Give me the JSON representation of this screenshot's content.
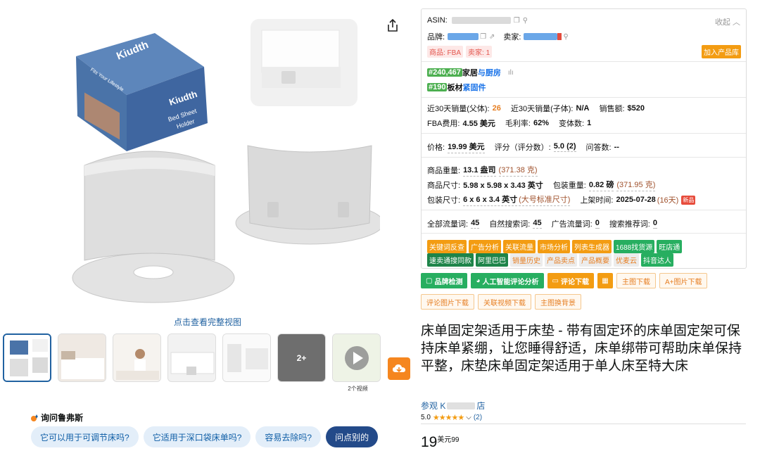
{
  "gallery": {
    "view_full_label": "点击查看完整视图",
    "video_count_label": "2个视频",
    "more_thumbs_label": "2+",
    "box_brand": "Kiudth",
    "box_slogan": "Fits Your Lifestyle",
    "box_product_lines": [
      "Bed Sheet",
      "Holder"
    ]
  },
  "rufus": {
    "title": "询问鲁弗斯",
    "questions": [
      "它可以用于可调节床吗?",
      "它适用于深口袋床单吗?",
      "容易去除吗?",
      "问点别的"
    ]
  },
  "panel": {
    "asin_label": "ASIN:",
    "collapse_label": "收起",
    "brand_label": "品牌:",
    "seller_label": "卖家:",
    "product_tag": "商品: FBA",
    "seller_tag": "卖家: 1",
    "add_library": "加入产品库",
    "rank1": {
      "rank": "#240,467",
      "cat1": "家居",
      "cat2": "与厨房"
    },
    "rank2": {
      "rank": "#190",
      "cat1": "板材",
      "cat2": "紧固件"
    },
    "sales30_parent_label": "近30天销量(父体):",
    "sales30_parent": "26",
    "sales30_child_label": "近30天销量(子体):",
    "sales30_child": "N/A",
    "revenue_label": "销售额:",
    "revenue": "$520",
    "fba_fee_label": "FBA费用:",
    "fba_fee": "4.55 美元",
    "margin_label": "毛利率:",
    "margin": "62%",
    "variants_label": "变体数:",
    "variants": "1",
    "price_label": "价格:",
    "price": "19.99 美元",
    "rating_label": "评分（评分数）:",
    "rating": "5.0 (2)",
    "qa_label": "问答数:",
    "qa": "--",
    "weight_label": "商品重量:",
    "weight": "13.1 盎司",
    "weight_alt": "(371.38 克)",
    "size_label": "商品尺寸:",
    "size": "5.98 x 5.98 x 3.43 英寸",
    "pkg_weight_label": "包装重量:",
    "pkg_weight": "0.82 磅",
    "pkg_weight_alt": "(371.95 克)",
    "pkg_size_label": "包装尺寸:",
    "pkg_size": "6 x 6 x 3.4 英寸",
    "pkg_size_note": "(大号标准尺寸)",
    "listed_label": "上架时间:",
    "listed": "2025-07-28",
    "listed_days": "(16天)",
    "new_tag": "新品",
    "all_kw_label": "全部流量词:",
    "all_kw": "45",
    "organic_kw_label": "自然搜索词:",
    "organic_kw": "45",
    "ad_kw_label": "广告流量词:",
    "ad_kw": "0",
    "rec_kw_label": "搜索推荐词:",
    "rec_kw": "0",
    "tools_row1": [
      "关键词反查",
      "广告分析",
      "关联流量",
      "市场分析",
      "列表生成器",
      "1688找货源",
      "旺店通"
    ],
    "tools_row2": [
      "速卖通搜同款",
      "阿里巴巴",
      "销量历史",
      "产品卖点",
      "产品概要",
      "优麦云",
      "抖音达人"
    ]
  },
  "actions": {
    "brand_check": "品牌检测",
    "ai_review": "人工智能评论分析",
    "review_download": "评论下载",
    "main_img_download": "主图下载",
    "aplus_download": "A+图片下载",
    "review_img_download": "评论图片下载",
    "video_download": "关联视频下载",
    "bg_replace": "主图换背景"
  },
  "product": {
    "title": "床单固定架适用于床垫 - 带有固定环的床单固定架可保持床单紧绷，让您睡得舒适，床单绑带可帮助床单保持平整，床垫床单固定架适用于单人床至特大床",
    "store_prefix": "参观 K",
    "store_suffix": "店",
    "rating": "5.0",
    "review_count": "(2)",
    "price_whole": "19",
    "price_currency": "美元",
    "price_fraction": "99"
  }
}
